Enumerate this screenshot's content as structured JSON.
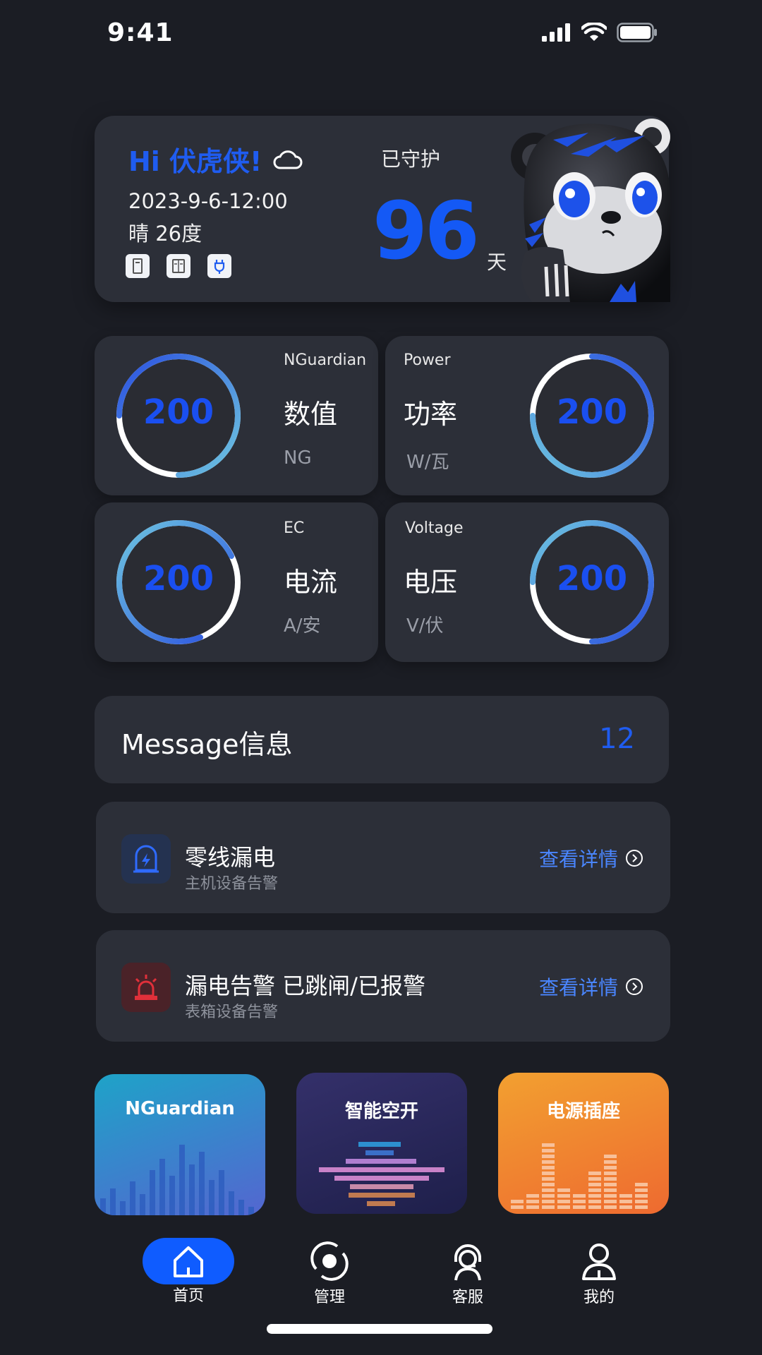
{
  "status": {
    "time": "9:41"
  },
  "hero": {
    "greeting": "Hi 伏虎侠!",
    "date": "2023-9-6-12:00",
    "weather": "晴 26度",
    "guard_label": "已守护",
    "days": "96",
    "days_unit": "天",
    "weather_icon": "cloud-icon",
    "device_icons": [
      "meter-icon",
      "breaker-box-icon",
      "plug-icon"
    ]
  },
  "metrics": [
    {
      "sub": "NGuardian",
      "title": "数值",
      "unit": "NG",
      "value": "200"
    },
    {
      "sub": "Power",
      "title": "功率",
      "unit": "W/瓦",
      "value": "200"
    },
    {
      "sub": "EC",
      "title": "电流",
      "unit": "A/安",
      "value": "200"
    },
    {
      "sub": "Voltage",
      "title": "电压",
      "unit": "V/伏",
      "value": "200"
    }
  ],
  "message": {
    "title": "Message信息",
    "count": "12"
  },
  "alerts": [
    {
      "title": "零线漏电",
      "sub": "主机设备告警",
      "link": "查看详情",
      "icon": "lightning-shield-icon"
    },
    {
      "title": "漏电告警 已跳闸/已报警",
      "sub": "表箱设备告警",
      "link": "查看详情",
      "icon": "alarm-siren-icon"
    }
  ],
  "tiles": [
    {
      "title": "NGuardian"
    },
    {
      "title": "智能空开"
    },
    {
      "title": "电源插座"
    }
  ],
  "tabs": [
    {
      "label": "首页",
      "icon": "home-icon"
    },
    {
      "label": "管理",
      "icon": "manage-icon"
    },
    {
      "label": "客服",
      "icon": "support-icon"
    },
    {
      "label": "我的",
      "icon": "profile-icon"
    }
  ],
  "colors": {
    "accent": "#1459f5",
    "background": "#1b1d24",
    "card": "#2c2f38",
    "alert_red": "#e0303a",
    "link": "#4a86ff"
  }
}
